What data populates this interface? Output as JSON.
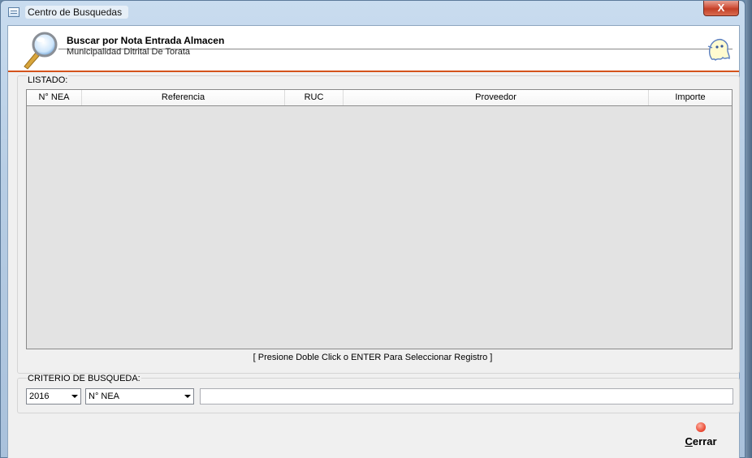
{
  "window": {
    "title": "Centro de Busquedas",
    "close_glyph": "X",
    "icon": "form-window-icon"
  },
  "header": {
    "title": "Buscar por Nota Entrada Almacen",
    "subtitle": "Municipalidad Ditrital De Torata",
    "left_icon": "magnifier-icon",
    "right_icon": "ghost-icon"
  },
  "listado": {
    "legend": "LISTADO:",
    "columns": [
      "N° NEA",
      "Referencia",
      "RUC",
      "Proveedor",
      "Importe"
    ],
    "rows": [],
    "hint": "[ Presione Doble Click o ENTER Para Seleccionar Registro ]"
  },
  "criterio": {
    "legend": "CRITERIO DE BUSQUEDA:",
    "year_value": "2016",
    "field_value": "N° NEA",
    "search_value": ""
  },
  "buttons": {
    "cerrar_first": "C",
    "cerrar_rest": "errar"
  },
  "colors": {
    "header_rule": "#d4531c",
    "grid_background": "#e3e3e3",
    "close_button": "#c33f27"
  }
}
